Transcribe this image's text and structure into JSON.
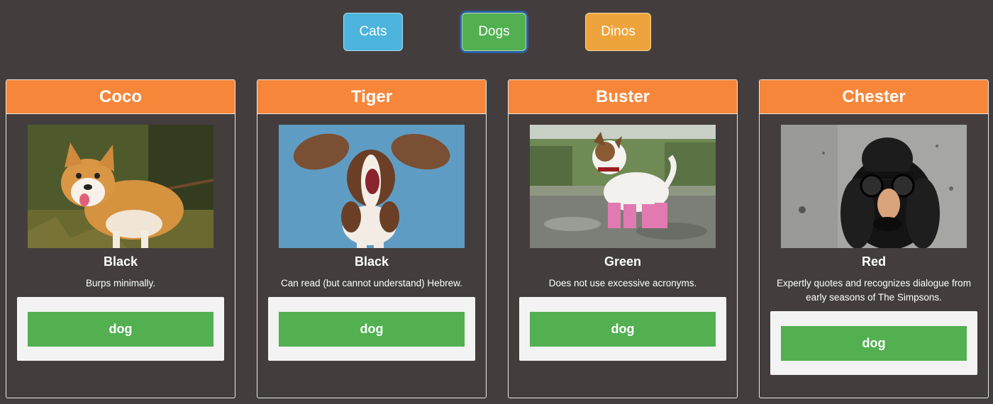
{
  "filters": [
    {
      "label": "Cats",
      "color": "#4db4dd",
      "selected": false
    },
    {
      "label": "Dogs",
      "color": "#52b051",
      "selected": true
    },
    {
      "label": "Dinos",
      "color": "#eea43c",
      "selected": false
    }
  ],
  "theme": {
    "background": "#433e3d",
    "header": "#f6863a",
    "type_button": "#52b051"
  },
  "cards": [
    {
      "name": "Coco",
      "color": "Black",
      "description": "Burps minimally.",
      "type": "dog"
    },
    {
      "name": "Tiger",
      "color": "Black",
      "description": "Can read (but cannot understand) Hebrew.",
      "type": "dog"
    },
    {
      "name": "Buster",
      "color": "Green",
      "description": "Does not use excessive acronyms.",
      "type": "dog"
    },
    {
      "name": "Chester",
      "color": "Red",
      "description": "Expertly quotes and recognizes dialogue from early seasons of The Simpsons.",
      "type": "dog"
    }
  ]
}
